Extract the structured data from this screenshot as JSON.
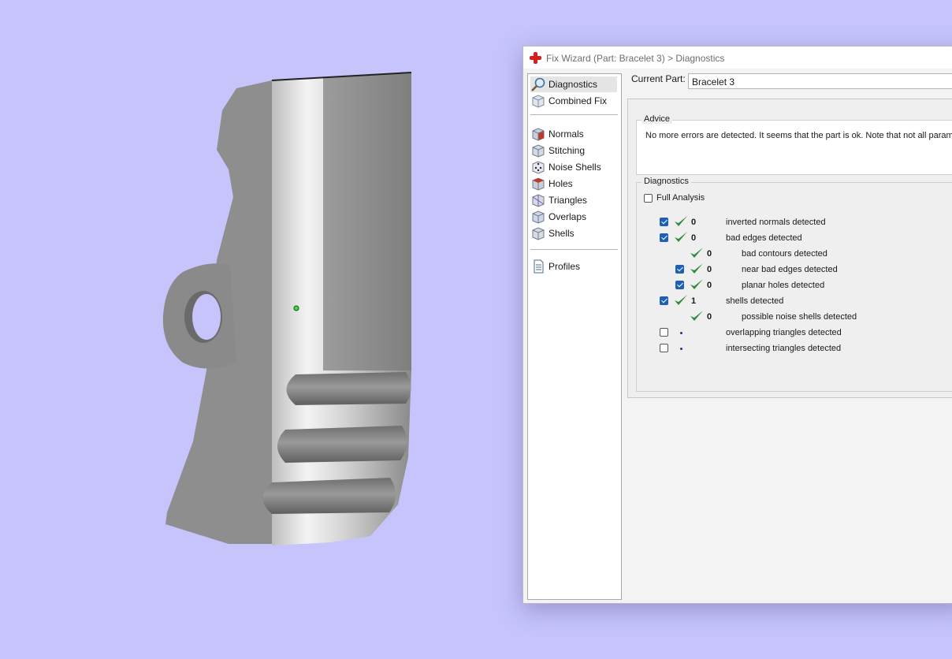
{
  "window": {
    "title": "Fix Wizard (Part: Bracelet 3) > Diagnostics"
  },
  "nav": {
    "items": [
      {
        "label": "Diagnostics",
        "icon": "magnifier-icon",
        "selected": true
      },
      {
        "label": "Combined Fix",
        "icon": "cube-icon"
      },
      {
        "label": "Normals",
        "icon": "cube-red-face-icon"
      },
      {
        "label": "Stitching",
        "icon": "cube-stitch-icon"
      },
      {
        "label": "Noise Shells",
        "icon": "dice-icon"
      },
      {
        "label": "Holes",
        "icon": "cube-hole-icon"
      },
      {
        "label": "Triangles",
        "icon": "cube-triangle-icon"
      },
      {
        "label": "Overlaps",
        "icon": "cube-overlap-icon"
      },
      {
        "label": "Shells",
        "icon": "cube-shell-icon"
      },
      {
        "label": "Profiles",
        "icon": "document-icon"
      }
    ]
  },
  "current_part": {
    "label": "Current Part:",
    "value": "Bracelet 3"
  },
  "advice": {
    "legend": "Advice",
    "text": "No more errors are detected. It seems that the part is ok. Note that not all param"
  },
  "diagnostics": {
    "legend": "Diagnostics",
    "full_analysis_label": "Full Analysis",
    "full_analysis_checked": false,
    "rows": [
      {
        "checkbox": true,
        "checked": true,
        "status": "ok",
        "count": "0",
        "label": "inverted normals detected",
        "indent": 0
      },
      {
        "checkbox": true,
        "checked": true,
        "status": "ok",
        "count": "0",
        "label": "bad edges detected",
        "indent": 0
      },
      {
        "checkbox": false,
        "checked": false,
        "status": "ok",
        "count": "0",
        "label": "bad contours detected",
        "indent": 1
      },
      {
        "checkbox": true,
        "checked": true,
        "status": "ok",
        "count": "0",
        "label": "near bad edges detected",
        "indent": 1
      },
      {
        "checkbox": true,
        "checked": true,
        "status": "ok",
        "count": "0",
        "label": "planar holes detected",
        "indent": 1
      },
      {
        "checkbox": true,
        "checked": true,
        "status": "ok",
        "count": "1",
        "label": "shells detected",
        "indent": 0
      },
      {
        "checkbox": false,
        "checked": false,
        "status": "ok",
        "count": "0",
        "label": "possible noise shells detected",
        "indent": 1
      },
      {
        "checkbox": true,
        "checked": false,
        "status": "pending",
        "count": "",
        "label": "overlapping triangles detected",
        "indent": 0
      },
      {
        "checkbox": true,
        "checked": false,
        "status": "pending",
        "count": "",
        "label": "intersecting triangles detected",
        "indent": 0
      }
    ]
  },
  "colors": {
    "background": "#c6c4fb",
    "check_green": "#2e8b3e",
    "checkbox_blue": "#1f5fb4",
    "model_gray": "#8f8f8f"
  }
}
